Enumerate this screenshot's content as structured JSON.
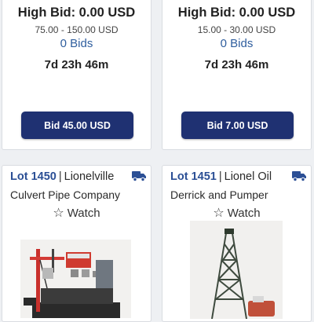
{
  "cards_top": [
    {
      "high_bid": "High Bid: 0.00 USD",
      "estimate": "75.00 - 150.00 USD",
      "bids": "0 Bids",
      "time_left": "7d 23h 46m",
      "button": "Bid 45.00 USD"
    },
    {
      "high_bid": "High Bid: 0.00 USD",
      "estimate": "15.00 - 30.00 USD",
      "bids": "0 Bids",
      "time_left": "7d 23h 46m",
      "button": "Bid 7.00 USD"
    }
  ],
  "cards_bottom": [
    {
      "lot": "Lot 1450",
      "sep": "|",
      "title_line1": "Lionelville",
      "title_line2": "Culvert Pipe Company",
      "watch": "Watch"
    },
    {
      "lot": "Lot 1451",
      "sep": "|",
      "title_line1": "Lionel Oil",
      "title_line2": "Derrick and Pumper",
      "watch": "Watch"
    }
  ],
  "colors": {
    "button": "#1f3172",
    "lot_link": "#2b4f95",
    "bids_link": "#2f5e9e"
  },
  "icons": {
    "shipping": "truck-icon",
    "watch": "star-outline-icon"
  }
}
